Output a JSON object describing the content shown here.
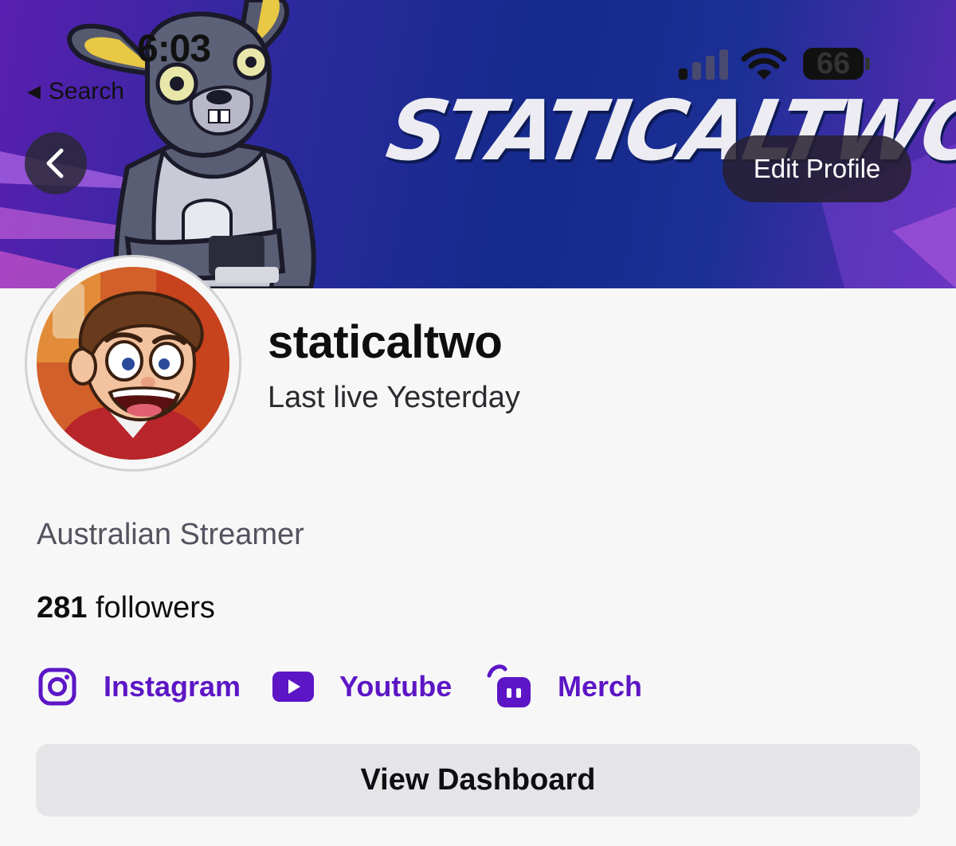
{
  "status_bar": {
    "time": "6:03",
    "back_label": "Search",
    "battery": "66"
  },
  "banner": {
    "wordmark": "STATICALTWO"
  },
  "header": {
    "edit_profile_label": "Edit Profile"
  },
  "profile": {
    "username": "staticaltwo",
    "last_live": "Last live Yesterday",
    "bio": "Australian Streamer",
    "followers_count": "281",
    "followers_label": "followers"
  },
  "links": [
    {
      "label": "Instagram",
      "icon": "instagram-icon"
    },
    {
      "label": "Youtube",
      "icon": "youtube-icon"
    },
    {
      "label": "Merch",
      "icon": "merch-icon"
    }
  ],
  "actions": {
    "dashboard_label": "View Dashboard"
  },
  "colors": {
    "accent": "#5c16c5",
    "background": "#f7f7f8",
    "button_bg": "#e5e5e8"
  }
}
